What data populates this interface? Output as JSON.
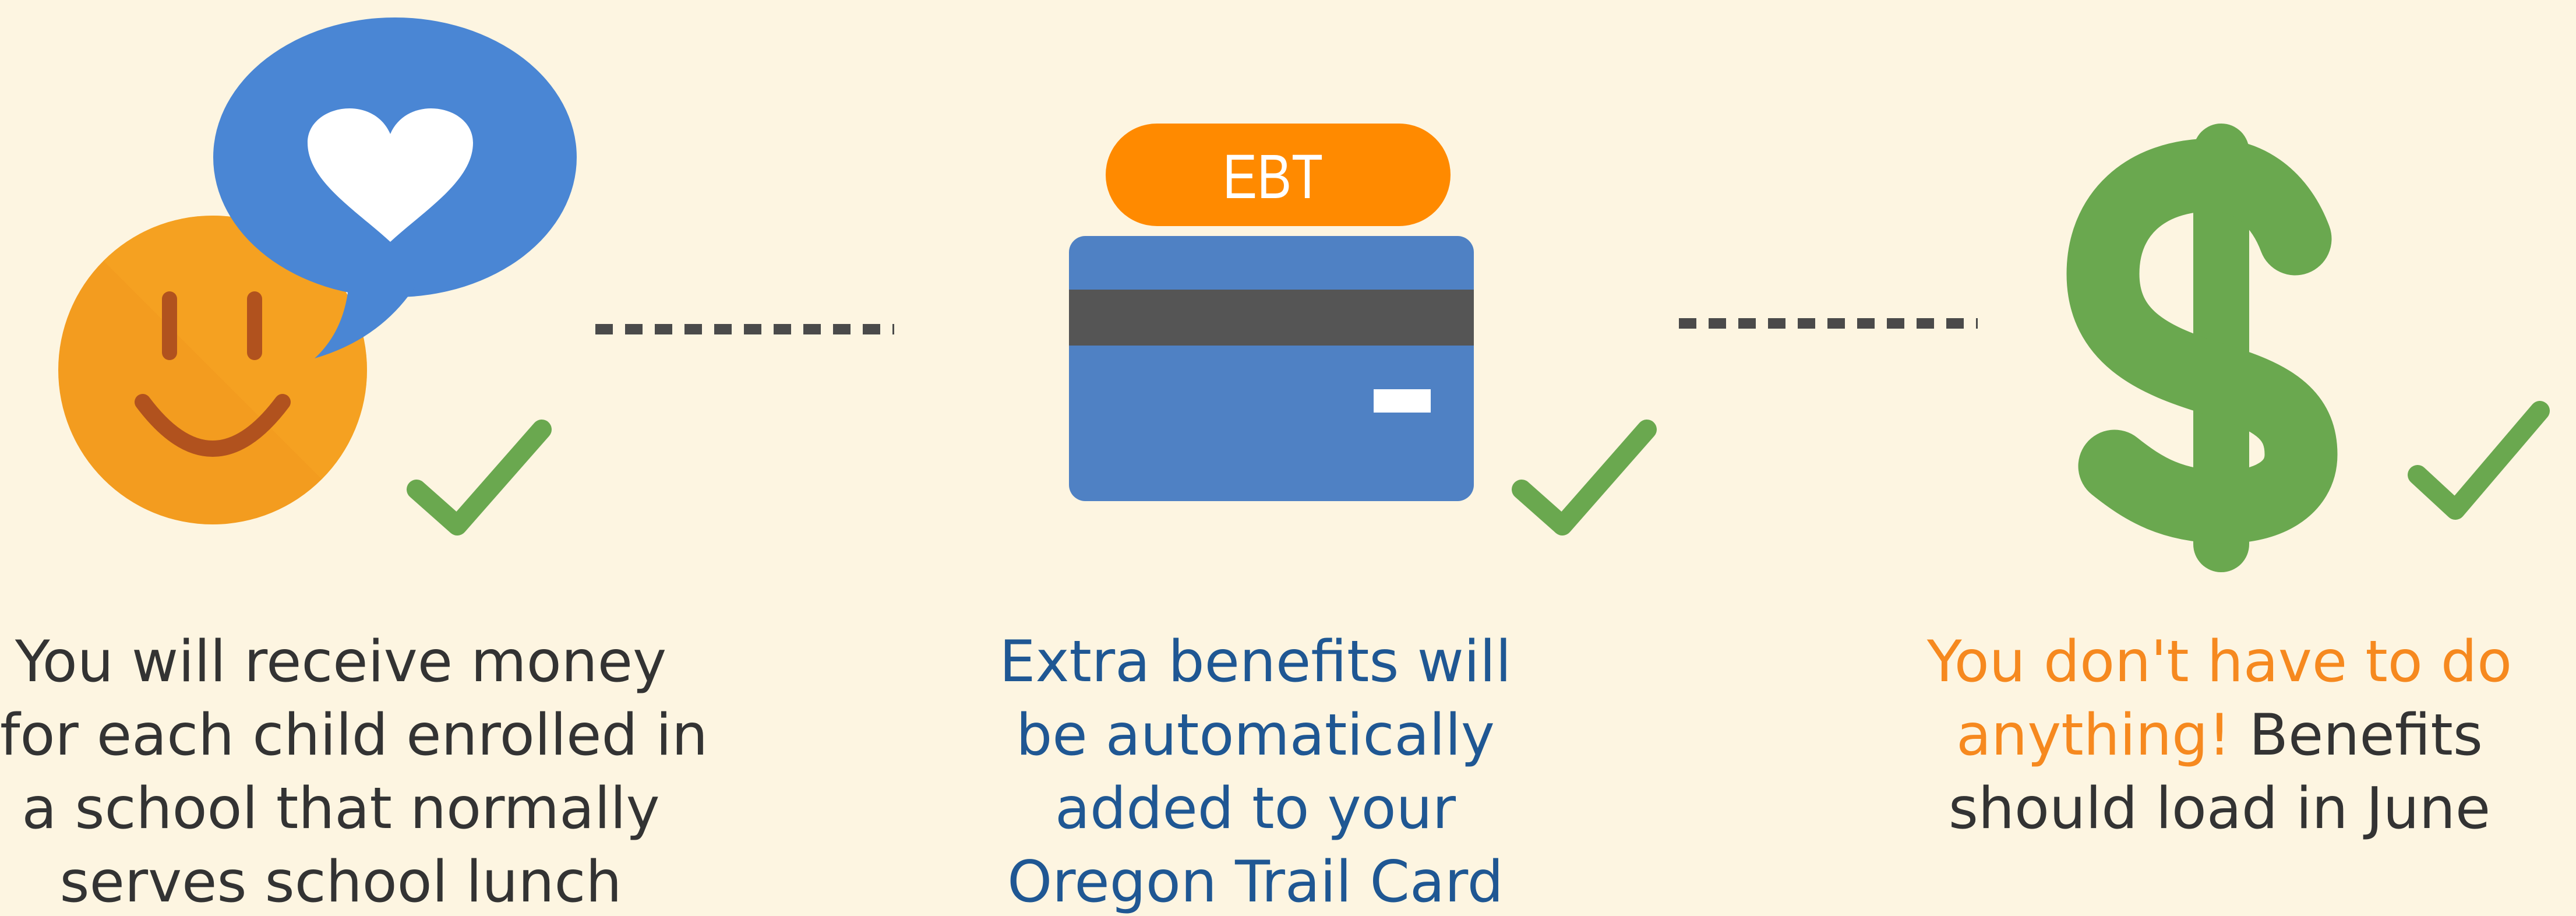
{
  "ebt_card": {
    "label": "EBT"
  },
  "steps": [
    {
      "lines": [
        "You will receive  money",
        "for each child enrolled in",
        "a school that normally",
        "serves school lunch"
      ]
    },
    {
      "lines": [
        "Extra benefits will",
        "be automatically",
        "added to your",
        "Oregon Trail Card"
      ]
    },
    {
      "line1": "You don't have to do",
      "line2_accent": "anything!",
      "line2_rest": " Benefits",
      "line3": "should load in June"
    }
  ],
  "colors": {
    "background": "#fdf5e1",
    "orange": "#f6891f",
    "blue_bubble": "#4a86d4",
    "card_blue": "#4f81c4",
    "green": "#6aa84f",
    "dark_text": "#333333",
    "blue_text": "#1f5793"
  },
  "icons": [
    "smiley-face-icon",
    "heart-speech-bubble-icon",
    "ebt-card-icon",
    "dollar-sign-icon",
    "checkmark-icon"
  ]
}
